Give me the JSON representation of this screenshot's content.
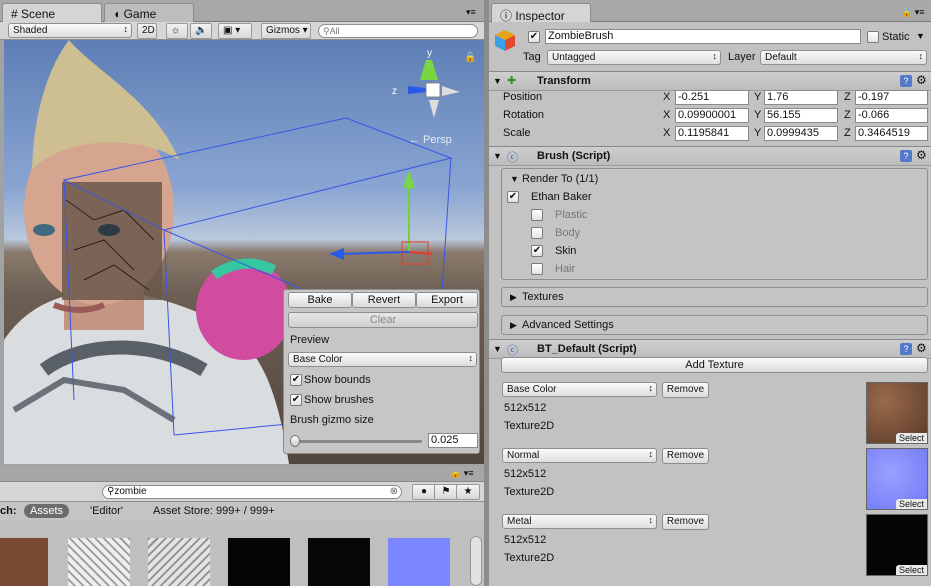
{
  "scene_window": {
    "tabs": [
      {
        "label": "Scene",
        "icon": "grid-icon"
      },
      {
        "label": "Game",
        "icon": "pacman-icon"
      }
    ],
    "toolbar": {
      "shading_mode": "Shaded",
      "mode_2d": "2D",
      "gizmos_label": "Gizmos",
      "search_placeholder": "All"
    },
    "persp_label": "← Persp",
    "brush_panel": {
      "bake_label": "Bake",
      "revert_label": "Revert",
      "export_label": "Export",
      "clear_label": "Clear",
      "preview_label": "Preview",
      "preview_mode": "Base Color",
      "show_bounds_label": "Show bounds",
      "show_bounds": true,
      "show_brushes_label": "Show brushes",
      "show_brushes": true,
      "gizmo_size_label": "Brush gizmo size",
      "gizmo_size_value": "0.025"
    },
    "project_window": {
      "search_value": "zombie",
      "search_prefix": "ch:",
      "filters": [
        "Assets",
        "'Editor'",
        "Asset Store: 999+ / 999+"
      ],
      "asset_colors": [
        "#7a4a32",
        "#cfcfcf",
        "#c6c6c6",
        "#050505",
        "#070707",
        "#7b86ff"
      ]
    }
  },
  "inspector": {
    "tab_label": "Inspector",
    "object_name": "ZombieBrush",
    "static_label": "Static",
    "active": true,
    "tag_label": "Tag",
    "tag_value": "Untagged",
    "layer_label": "Layer",
    "layer_value": "Default",
    "transform": {
      "title": "Transform",
      "rows": [
        {
          "label": "Position",
          "x": "-0.251",
          "y": "1.76",
          "z": "-0.197"
        },
        {
          "label": "Rotation",
          "x": "0.09900001",
          "y": "56.155",
          "z": "-0.066"
        },
        {
          "label": "Scale",
          "x": "0.1195841",
          "y": "0.0999435",
          "z": "0.3464519"
        }
      ],
      "axis_x": "X",
      "axis_y": "Y",
      "axis_z": "Z"
    },
    "brush_script": {
      "title": "Brush (Script)",
      "render_to_label": "Render To (1/1)",
      "owner": {
        "label": "Ethan Baker",
        "checked": true
      },
      "items": [
        {
          "label": "Plastic",
          "checked": false
        },
        {
          "label": "Body",
          "checked": false
        },
        {
          "label": "Skin",
          "checked": true
        },
        {
          "label": "Hair",
          "checked": false
        }
      ],
      "textures_label": "Textures",
      "advanced_label": "Advanced Settings"
    },
    "bt_default": {
      "title": "BT_Default (Script)",
      "add_texture_label": "Add Texture",
      "remove_label": "Remove",
      "select_label": "Select",
      "textures": [
        {
          "channel": "Base Color",
          "size": "512x512",
          "type": "Texture2D",
          "color": "#6e4630"
        },
        {
          "channel": "Normal",
          "size": "512x512",
          "type": "Texture2D",
          "color": "#7f86ff"
        },
        {
          "channel": "Metal",
          "size": "512x512",
          "type": "Texture2D",
          "color": "#050505"
        }
      ]
    }
  }
}
